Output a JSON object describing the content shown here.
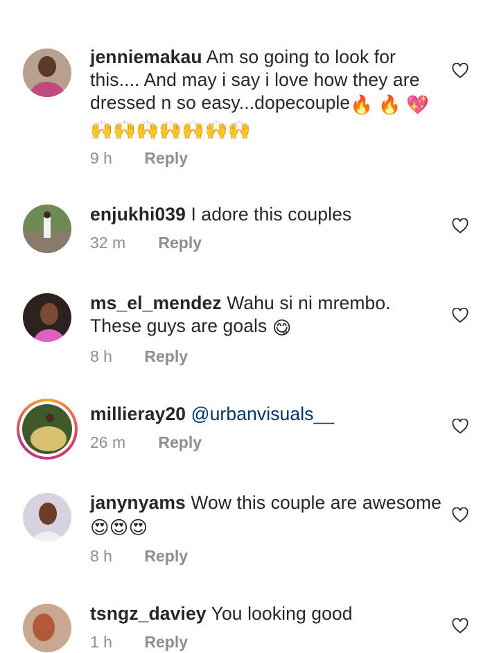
{
  "comments": [
    {
      "username": "jenniemakau",
      "text": "Am so going to look for this.... And may i say i love how they are dressed n so easy...dopecouple",
      "emoji_line2": "🙌🙌🙌🙌🙌🙌🙌",
      "trailing_emojis": "🔥 🔥 💖",
      "time": "9 h",
      "reply": "Reply",
      "icon": "heart-outline-icon"
    },
    {
      "username": "enjukhi039",
      "text": "I adore this couples",
      "time": "32 m",
      "reply": "Reply",
      "icon": "heart-outline-icon"
    },
    {
      "username": "ms_el_mendez",
      "text": "Wahu si ni mrembo. These guys are goals",
      "trailing_emojis": "😋",
      "time": "8 h",
      "reply": "Reply",
      "icon": "heart-outline-icon"
    },
    {
      "username": "millieray20",
      "mention": "@urbanvisuals__",
      "time": "26 m",
      "reply": "Reply",
      "icon": "heart-outline-icon"
    },
    {
      "username": "janynyams",
      "text": "Wow this couple are awesome",
      "trailing_emojis": "😍😍😍",
      "time": "8 h",
      "reply": "Reply",
      "icon": "heart-outline-icon"
    },
    {
      "username": "tsngz_daviey",
      "text": "You looking good",
      "time": "1 h",
      "reply": "Reply",
      "icon": "heart-outline-icon"
    }
  ],
  "colors": {
    "text": "#262626",
    "meta": "#8e8e8e",
    "mention": "#003569",
    "story_ring": "#e1306c"
  }
}
